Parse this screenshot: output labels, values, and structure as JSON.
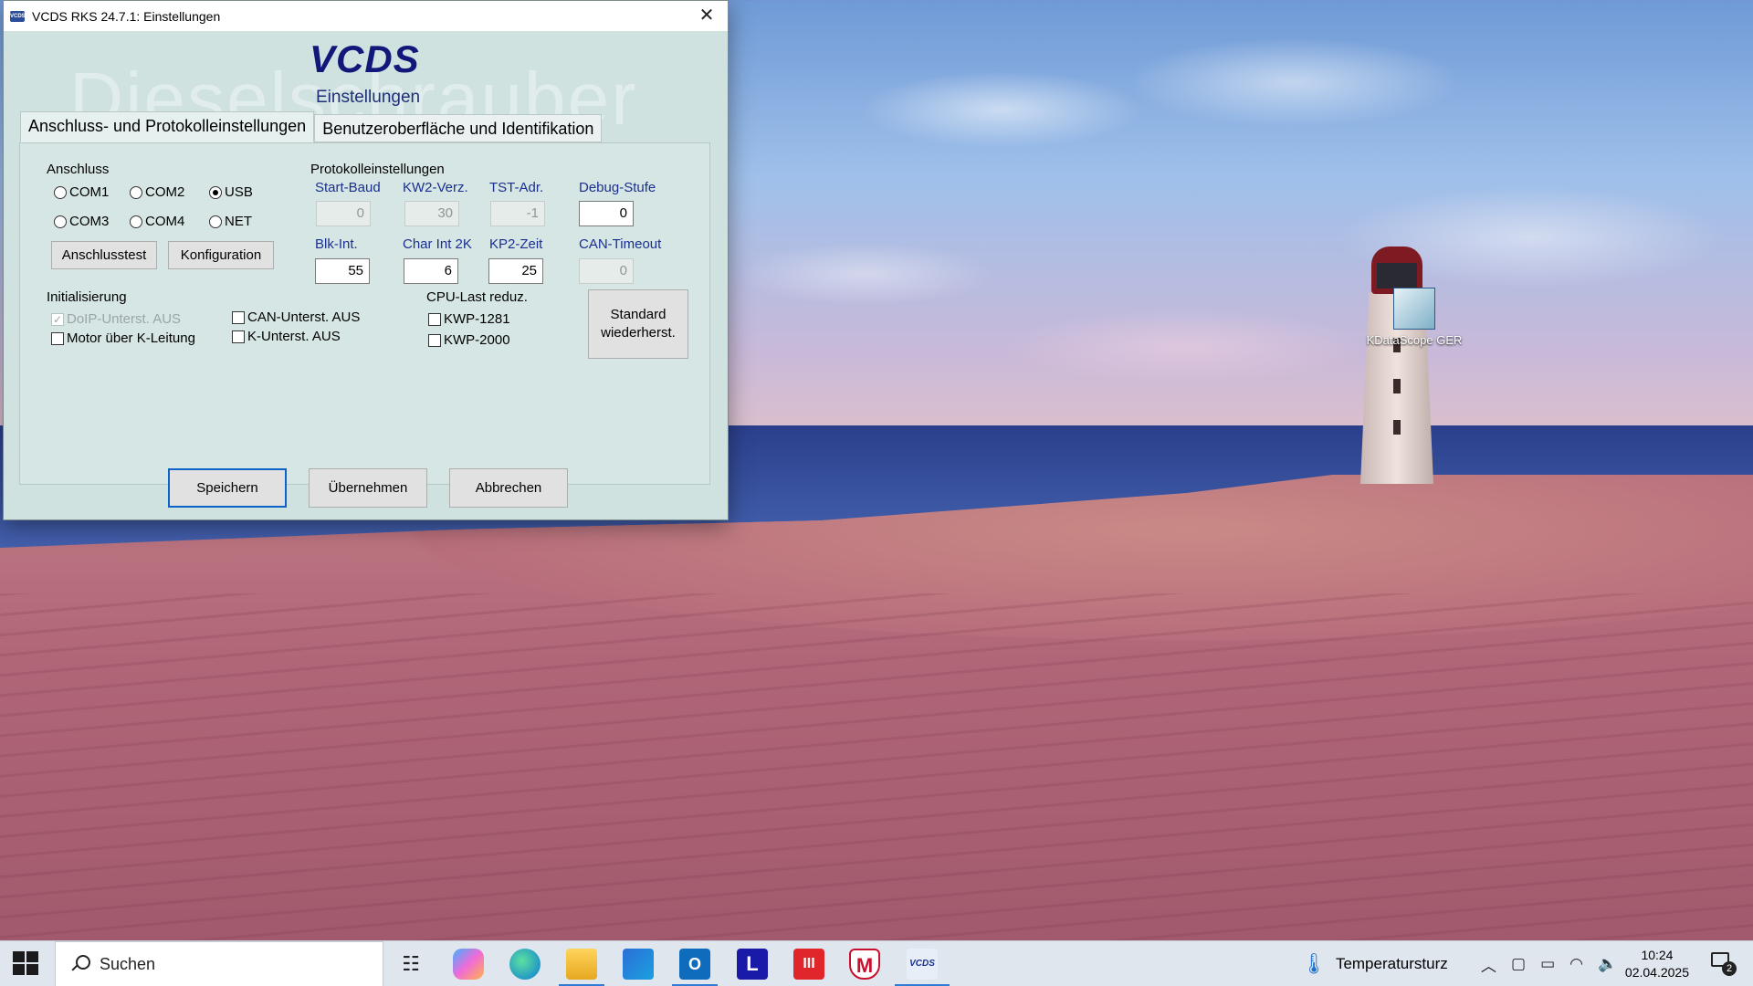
{
  "window": {
    "title": "VCDS RKS 24.7.1:  Einstellungen",
    "close_glyph": "✕",
    "logo": "VCDS",
    "subtitle": "Einstellungen",
    "watermark": "Dieselschrauber"
  },
  "tabs": [
    {
      "label": "Anschluss- und Protokolleinstellungen",
      "active": true
    },
    {
      "label": "Benutzeroberfläche und Identifikation",
      "active": false
    }
  ],
  "anschluss": {
    "heading": "Anschluss",
    "ports": [
      "COM1",
      "COM2",
      "USB",
      "COM3",
      "COM4",
      "NET"
    ],
    "selected": "USB",
    "test_button": "Anschlusstest",
    "config_button": "Konfiguration"
  },
  "protokoll": {
    "heading": "Protokolleinstellungen",
    "start_baud": {
      "label": "Start-Baud",
      "value": "0"
    },
    "kw2_verz": {
      "label": "KW2-Verz.",
      "value": "30"
    },
    "tst_adr": {
      "label": "TST-Adr.",
      "value": "-1"
    },
    "debug_stufe": {
      "label": "Debug-Stufe",
      "value": "0"
    },
    "blk_int": {
      "label": "Blk-Int.",
      "value": "55"
    },
    "char_int": {
      "label": "Char Int 2K",
      "value": "6"
    },
    "kp2_zeit": {
      "label": "KP2-Zeit",
      "value": "25"
    },
    "can_timeout": {
      "label": "CAN-Timeout",
      "value": "0"
    }
  },
  "init": {
    "heading": "Initialisierung",
    "doip": "DoIP-Unterst. AUS",
    "motor": "Motor über K-Leitung",
    "can": "CAN-Unterst. AUS",
    "k": "K-Unterst. AUS"
  },
  "cpu": {
    "heading": "CPU-Last reduz.",
    "kwp1281": "KWP-1281",
    "kwp2000": "KWP-2000"
  },
  "restore_button": "Standard\nwiederherst.",
  "footer": {
    "save": "Speichern",
    "apply": "Übernehmen",
    "cancel": "Abbrechen"
  },
  "desktop": {
    "icon_label": "KDataScope GER"
  },
  "taskbar": {
    "search_placeholder": "Suchen",
    "weather": "Temperatursturz",
    "time": "10:24",
    "date": "02.04.2025",
    "notification_count": "2",
    "apps": [
      "task-view",
      "copilot",
      "edge",
      "file-explorer",
      "store",
      "outlook",
      "L",
      "III",
      "M",
      "VCDS"
    ],
    "l_label": "L",
    "iii_label": "III",
    "m_label": "M",
    "vcds_label": "VCDS"
  },
  "colors": {
    "dialog_bg": "#cfe2e0",
    "label_blue": "#1a2f8f",
    "accent": "#0b62c7"
  }
}
